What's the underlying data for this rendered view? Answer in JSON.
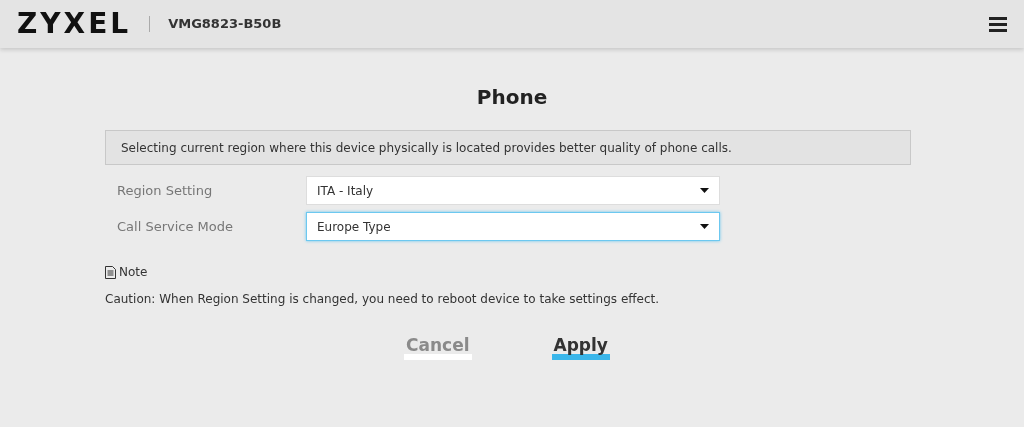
{
  "header": {
    "logo": "ZYXEL",
    "model": "VMG8823-B50B"
  },
  "page": {
    "title": "Phone"
  },
  "info": "Selecting current region where this device physically is located provides better quality of phone calls.",
  "fields": [
    {
      "label": "Region Setting",
      "value": "ITA - Italy",
      "focused": false
    },
    {
      "label": "Call Service Mode",
      "value": "Europe Type",
      "focused": true
    }
  ],
  "note": {
    "title": "Note",
    "text": "Caution: When Region Setting is changed, you need to reboot device to take settings effect."
  },
  "buttons": [
    {
      "label": "Cancel",
      "kind": "secondary"
    },
    {
      "label": "Apply",
      "kind": "primary"
    }
  ]
}
